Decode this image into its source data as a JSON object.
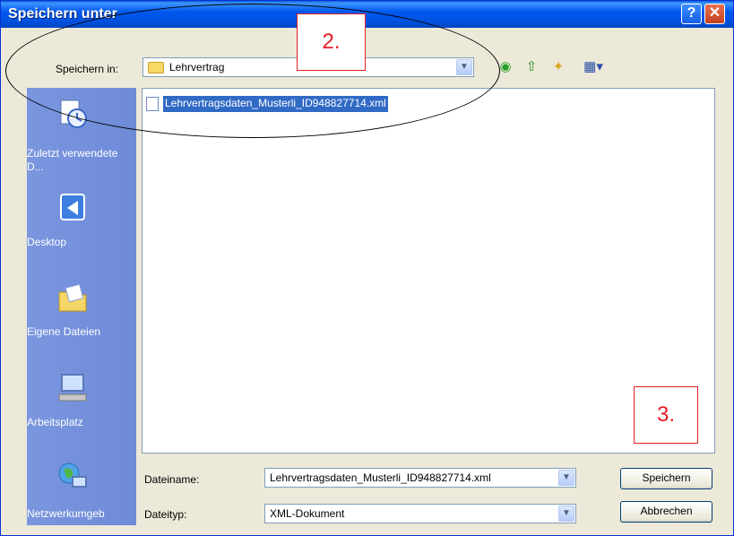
{
  "window": {
    "title": "Speichern unter"
  },
  "title_buttons": {
    "help": "?",
    "close": "✕"
  },
  "save_in": {
    "label": "Speichern in:",
    "value": "Lehrvertrag"
  },
  "toolbar": {
    "icons": [
      "back-icon",
      "up-folder-icon",
      "new-folder-icon",
      "view-menu-icon"
    ]
  },
  "places": [
    {
      "label": "Zuletzt verwendete D...",
      "icon": "recent-documents-icon"
    },
    {
      "label": "Desktop",
      "icon": "desktop-icon"
    },
    {
      "label": "Eigene Dateien",
      "icon": "my-documents-icon"
    },
    {
      "label": "Arbeitsplatz",
      "icon": "my-computer-icon"
    },
    {
      "label": "Netzwerkumgeb",
      "icon": "network-icon"
    }
  ],
  "files": [
    {
      "name": "Lehrvertragsdaten_Musterli_ID948827714.xml",
      "selected": true
    }
  ],
  "filename": {
    "label": "Dateiname:",
    "value": "Lehrvertragsdaten_Musterli_ID948827714.xml"
  },
  "filetype": {
    "label": "Dateityp:",
    "value": "XML-Dokument"
  },
  "buttons": {
    "save": "Speichern",
    "cancel": "Abbrechen"
  },
  "annotations": {
    "step2": "2.",
    "step3": "3."
  },
  "colors": {
    "title_bar": "#0054e3",
    "places_bar": "#7a96df",
    "selection": "#316ac5",
    "annotation": "#e31e24"
  }
}
